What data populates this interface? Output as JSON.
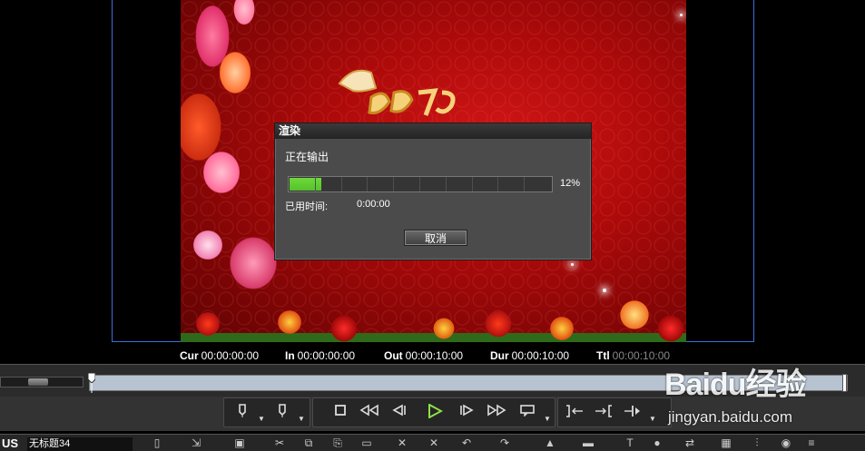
{
  "dialog": {
    "title": "渲染",
    "status": "正在输出",
    "progress_percent": 12,
    "progress_text": "12%",
    "elapsed_label": "已用时间:",
    "elapsed_value": "0:00:00",
    "cancel_label": "取消"
  },
  "timecodes": {
    "cur_label": "Cur",
    "cur_value": "00:00:00:00",
    "in_label": "In",
    "in_value": "00:00:00:00",
    "out_label": "Out",
    "out_value": "00:00:10:00",
    "dur_label": "Dur",
    "dur_value": "00:00:10:00",
    "ttl_label": "Ttl",
    "ttl_value": "00:00:10:00"
  },
  "project": {
    "app_label": "US",
    "name": "无标题34"
  },
  "watermark": {
    "logo": "Baidu经验",
    "url": "jingyan.baidu.com"
  },
  "colors": {
    "progress": "#55c22a",
    "play_icon": "#8fe04a",
    "preview_border": "#3a6fd8"
  },
  "icons": {
    "transport": [
      "mark-in-icon",
      "mark-out-icon",
      "stop-icon",
      "rewind-icon",
      "step-back-icon",
      "play-icon",
      "step-forward-icon",
      "fast-forward-icon",
      "loop-icon",
      "go-to-in-icon",
      "go-to-out-icon",
      "split-icon"
    ]
  }
}
